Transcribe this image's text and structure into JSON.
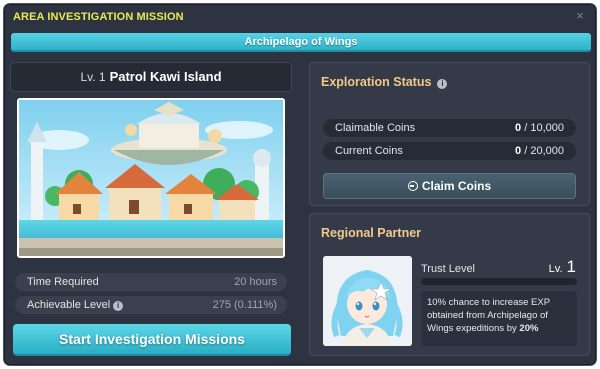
{
  "window": {
    "title": "AREA INVESTIGATION MISSION",
    "close_symbol": "×",
    "region": "Archipelago of Wings"
  },
  "mission": {
    "level_label": "Lv. 1",
    "name": "Patrol Kawi Island",
    "image": "island-town-illustration",
    "time_required_label": "Time Required",
    "time_required_value": "20 hours",
    "achievable_level_label": "Achievable Level",
    "achievable_level_value": "275 (0.111%)",
    "start_button": "Start Investigation Missions"
  },
  "exploration": {
    "title": "Exploration Status",
    "claimable_label": "Claimable Coins",
    "claimable_current": "0",
    "claimable_max": "10,000",
    "current_label": "Current Coins",
    "current_value": "0",
    "current_max": "20,000",
    "claim_button": "Claim Coins"
  },
  "partner": {
    "title": "Regional Partner",
    "trust_label": "Trust Level",
    "lv_label": "Lv.",
    "lv_value": "1",
    "trust_progress": 0,
    "desc_pre": "10% chance to increase EXP obtained from Archipelago of Wings expeditions by ",
    "desc_bonus": "20%"
  },
  "colors": {
    "title_yellow": "#e8eb56",
    "accent_cyan": "#3fc0d4",
    "panel_title": "#f2c98a"
  },
  "icons": {
    "info": "info-icon",
    "claim": "minus-circle-icon",
    "close": "close-icon"
  }
}
